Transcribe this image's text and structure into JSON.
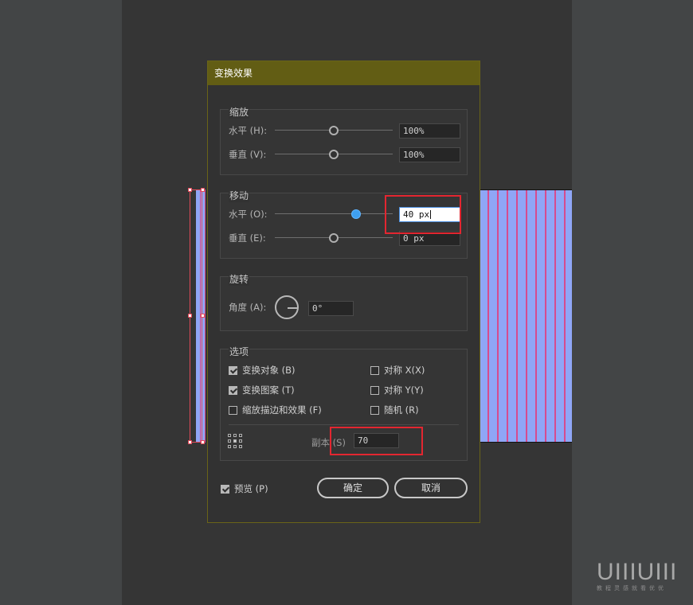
{
  "dialog": {
    "title": "变换效果",
    "scale": {
      "title": "缩放",
      "horizontal": {
        "label": "水平 (H):",
        "value": "100%",
        "slider": 0.5
      },
      "vertical": {
        "label": "垂直 (V):",
        "value": "100%",
        "slider": 0.5
      }
    },
    "move": {
      "title": "移动",
      "horizontal": {
        "label": "水平 (O):",
        "value": "40 px",
        "slider": 0.69
      },
      "vertical": {
        "label": "垂直 (E):",
        "value": "0 px",
        "slider": 0.5
      }
    },
    "rotate": {
      "title": "旋转",
      "angle": {
        "label": "角度 (A):",
        "value": "0°"
      }
    },
    "options": {
      "title": "选项",
      "transform_objects": {
        "label": "变换对象 (B)",
        "checked": true
      },
      "transform_patterns": {
        "label": "变换图案 (T)",
        "checked": true
      },
      "scale_strokes": {
        "label": "缩放描边和效果 (F)",
        "checked": false
      },
      "reflect_x": {
        "label": "对称 X(X)",
        "checked": false
      },
      "reflect_y": {
        "label": "对称 Y(Y)",
        "checked": false
      },
      "random": {
        "label": "随机 (R)",
        "checked": false
      },
      "copies": {
        "label": "副本 (S)",
        "value": "70"
      }
    },
    "preview": {
      "label": "预览 (P)",
      "checked": true
    },
    "ok_label": "确定",
    "cancel_label": "取消"
  },
  "watermark": {
    "logo": "UIIIUIII",
    "subtitle": "教程灵感就看优优"
  },
  "colors": {
    "title_bar": "#625d14",
    "slider_active": "#3e9ff0",
    "highlight": "#e32630",
    "artwork_fill": "#8fa6f6",
    "artwork_stroke": "#d64b8f"
  }
}
